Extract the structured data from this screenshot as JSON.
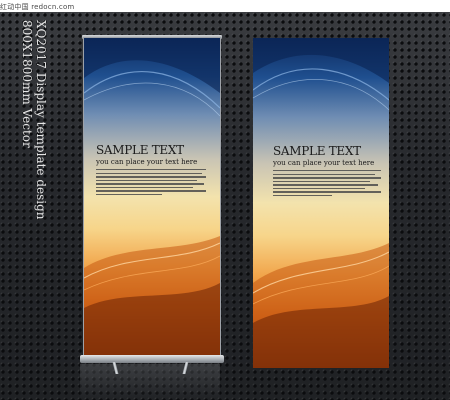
{
  "watermark": "红动中国 redocn.com",
  "caption": {
    "line1": "XQ2017 Display template design",
    "line2": "800X1800mm Vector"
  },
  "banners": [
    {
      "title": "SAMPLE TEXT",
      "subtitle": "you can place your text here"
    },
    {
      "title": "SAMPLE TEXT",
      "subtitle": "you can place your text here"
    }
  ],
  "colors": {
    "backdrop": "#27292d",
    "banner_top_blue": "#0d2a5e",
    "banner_middle_cream": "#f3e3ad",
    "banner_bottom_orange": "#d66a1c"
  }
}
